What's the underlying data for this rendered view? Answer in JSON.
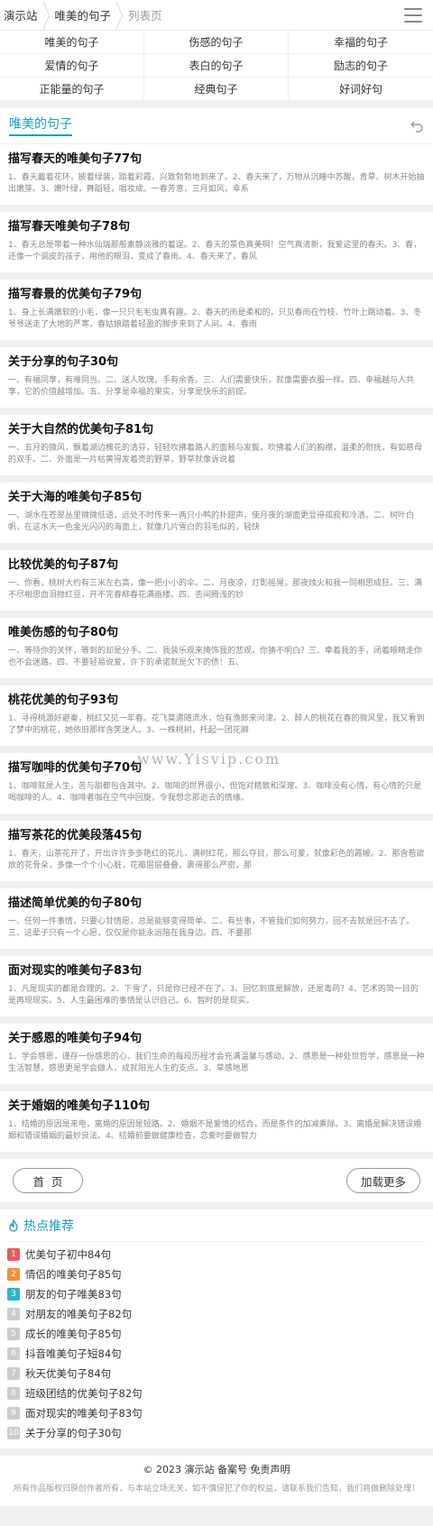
{
  "header": {
    "breadcrumbs": [
      "演示站",
      "唯美的句子",
      "列表页"
    ]
  },
  "categories": [
    "唯美的句子",
    "伤感的句子",
    "幸福的句子",
    "爱情的句子",
    "表白的句子",
    "励志的句子",
    "正能量的句子",
    "经典句子",
    "好词好句"
  ],
  "section": {
    "title": "唯美的句子"
  },
  "articles": [
    {
      "title": "描写春天的唯美句子77句",
      "desc": "1、春天戴着花环，披着绿装，踏着彩霞，兴致勃勃地到来了。2、春天来了，万物从沉睡中苏醒，青草、树木开始抽出嫩芽。3、嫩叶绿，舞蹈轻，唱妆成。一春芳意，三月如风，幸系"
    },
    {
      "title": "描写春天唯美句子78句",
      "desc": "1、春天总是带着一种水仙瑞那般素静淡雅的着逞。2、春天的景色真美啊！空气真清新，我爱这里的春天。3、春，还像一个调皮的孩子，用他的眼泪，变成了春雨。4、春天来了，春风"
    },
    {
      "title": "描写春景的优美句子79句",
      "desc": "1、身上长满嫩软的小毛，像一只只毛毛虫真有趣。2、春天的雨是柔和的，只见春雨在竹枝、竹叶上跳动着。3、冬爷爷送走了大地的严寒，春姑娘踏着轻盈的脚步来到了人间。4、春雨"
    },
    {
      "title": "关于分享的句子30句",
      "desc": "一、有福同享，有难同当。二、送人玫瑰，手有余香。三、人们需要快乐，就像需要衣服一样。四、幸福越与人共享，它的价值越增加。五、分享是幸福的果实，分享是快乐的前提。"
    },
    {
      "title": "关于大自然的优美句子81句",
      "desc": "一、五月的微风，飘着湖边槐花的清芬，轻轻吹拂着路人的面颊与发鬓，吹拂着人们的胸襟，温柔的慰抚，有如慈母的双手。二、外面是一片枯黄得发着亮的野草，野草就像诉说着"
    },
    {
      "title": "关于大海的唯美句子85句",
      "desc": "一、湖水在苍翠丛里微微低语，远处不时传来一两只小鸭的扑翅声，使月夜的湖面更显得孤寂和冷清。二、树叶白帆，在这水天一色金光闪闪的海面上，就像几片雪白的羽毛似的，轻快"
    },
    {
      "title": "比较优美的句子87句",
      "desc": "一、你看，桃树大约有三米左右高，像一把小小的伞。二、月夜凉，灯影摇晃，那夜烛火和我一同相思成狂。三、满不尽相思血泪抛红豆，开不完春柳春花满画楼。四、否间腾浅的妙"
    },
    {
      "title": "唯美伤感的句子80句",
      "desc": "一、等待你的关怀，等到的却是分手。二、我装乐观来掩饰我的悲观，你猜不明白？三、牵着我的手，闭着眼睛走你也不会迷路。四、不要轻易说爱，许下的承诺就是欠下的债！五、"
    },
    {
      "title": "桃花优美的句子93句",
      "desc": "1、寻得桃源好避秦，桃红又见一年春。花飞莫遣随流水，怕有渔郎来问津。2、醉人的桃花在春的微风里，我又看到了梦中的桃花，她依旧那样含笑迷人。3、一株桃树，托起一团花脚"
    },
    {
      "title": "描写咖啡的优美句子70句",
      "desc": "1、咖啡就是人生，苦与甜都包含其中。2、咖啡的世界很小，但饱对精致和深邃。3、咖啡没有心情，有心情的只是喝咖啡的人。4、咖啡者咖在空气中回旋，令我想念那逝去的情缘。"
    },
    {
      "title": "描写茶花的优美段落45句",
      "desc": "1、春天，山茶花开了，开出许许多多艳红的花儿，满树红花，那么夺目，那么可爱，就像彩色的霞帔。2、那含苞欲放的花骨朵，多像一个个小心脏，花瓣层层叠叠，裹得那么严密，那"
    },
    {
      "title": "描述简单优美的句子80句",
      "desc": "一、任何一件事情，只要心甘情愿，总是能够变得简单。二、有些事，不管我们如何努力，回不去就是回不去了。三、这辈子只有一个心愿，仅仅是你能永远陪在我身边。四、不要那"
    },
    {
      "title": "面对现实的唯美句子83句",
      "desc": "1、凡是现实的都是合理的。2、下雪了，只是你已经不在了。3、回忆到底是解放，还是毒药？4、艺术的简一目的是再现现实。5、人生最困难的事情是认识自己。6、智时的是现实。"
    },
    {
      "title": "关于感恩的唯美句子94句",
      "desc": "1、学会感恩，谨存一份感恩的心，我们生命的每段历程才会充满温馨与感动。2、感恩是一种处世哲学，感恩是一种生活智慧，感恩更是学会做人，成就阳光人生的支点。3、草感地恩"
    },
    {
      "title": "关于婚姻的唯美句子110句",
      "desc": "1、结婚的原因是来电，离婚的原因是短路。2、婚姻不是爱情的结合，而是条件的加减乘除。3、离婚是解决错误婚姻和错误婚姻的最妙良法。4、结婚前要做健康检查，恋爱时要做智力"
    }
  ],
  "pager": {
    "home_label": "首页",
    "more_label": "加载更多"
  },
  "hot": {
    "title": "热点推荐",
    "items": [
      {
        "rank": "1",
        "label": "优美句子初中84句",
        "color": "#e95a5a"
      },
      {
        "rank": "2",
        "label": "情侣的唯美句子85句",
        "color": "#f0913a"
      },
      {
        "rank": "3",
        "label": "朋友的句子唯美83句",
        "color": "#2ab5c8"
      },
      {
        "rank": "4",
        "label": "对朋友的唯美句子82句",
        "color": "#cccccc"
      },
      {
        "rank": "5",
        "label": "成长的唯美句子85句",
        "color": "#cccccc"
      },
      {
        "rank": "6",
        "label": "抖音唯美句子短84句",
        "color": "#cccccc"
      },
      {
        "rank": "7",
        "label": "秋天优美句子84句",
        "color": "#cccccc"
      },
      {
        "rank": "8",
        "label": "班级团结的优美句子82句",
        "color": "#cccccc"
      },
      {
        "rank": "9",
        "label": "面对现实的唯美句子83句",
        "color": "#cccccc"
      },
      {
        "rank": "10",
        "label": "关于分享的句子30句",
        "color": "#cccccc"
      }
    ]
  },
  "footer": {
    "copyright": "© 2023 演示站 备案号 免责声明",
    "notice": "所有作品版权归原创作者所有，与本站立场无关，如不慎侵犯了你的权益，请联系我们告知，我们将做删除处理！"
  },
  "watermark": "www.Yisvip.com",
  "colors": {
    "accent": "#19a0b8"
  }
}
